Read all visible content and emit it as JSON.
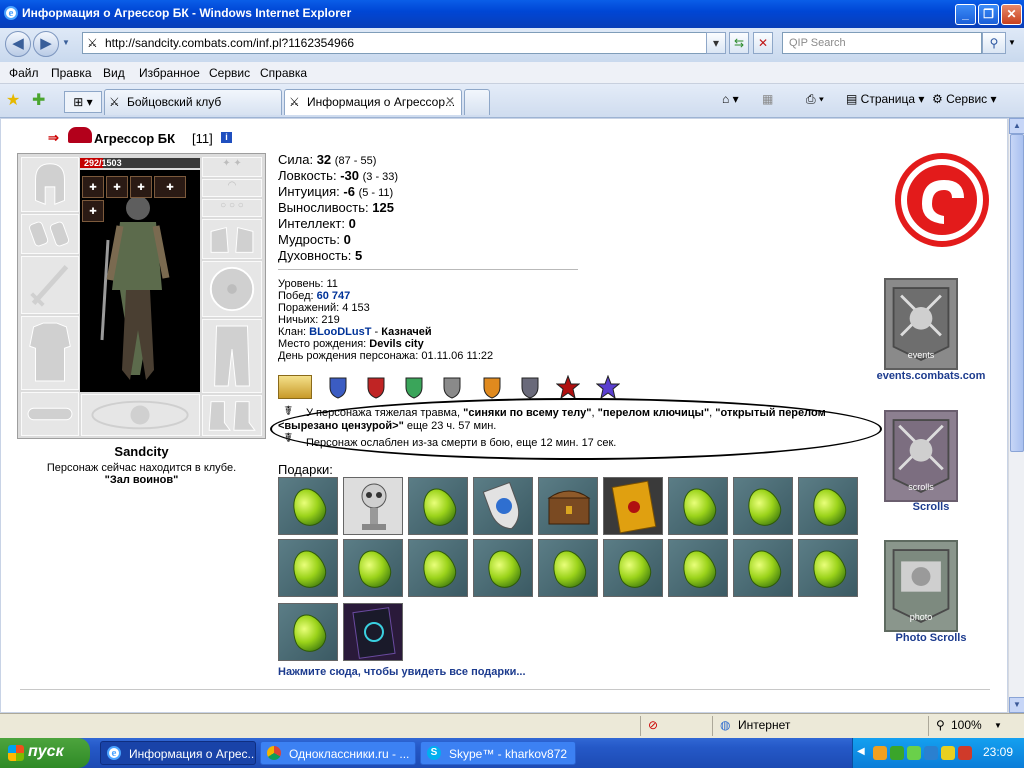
{
  "window": {
    "title": "Информация о Агрессор БК - Windows Internet Explorer"
  },
  "address_bar": {
    "url": "http://sandcity.combats.com/inf.pl?1162354966",
    "search_placeholder": "QIP Search"
  },
  "menu": [
    "Файл",
    "Правка",
    "Вид",
    "Избранное",
    "Сервис",
    "Справка"
  ],
  "tabs": [
    {
      "label": "Бойцовский клуб"
    },
    {
      "label": "Информация о Агрессор..."
    }
  ],
  "toolbar": {
    "page_label": "Страница",
    "service_label": "Сервис"
  },
  "character": {
    "name": "Агрессор БК",
    "level_tag": "[11]",
    "info_icon": "i",
    "hp": "292",
    "hp_max": "1503",
    "hp_fraction": 0.194,
    "city": "Sandcity",
    "location_text": "Персонаж сейчас находится в клубе.",
    "location_name": "\"Зал воинов\""
  },
  "stats": [
    {
      "name": "Сила:",
      "value": "32",
      "range": "(87 - 55)"
    },
    {
      "name": "Ловкость:",
      "value": "-30",
      "range": "(3 - 33)"
    },
    {
      "name": "Интуиция:",
      "value": "-6",
      "range": "(5 - 11)"
    },
    {
      "name": "Выносливость:",
      "value": "125",
      "range": ""
    },
    {
      "name": "Интеллект:",
      "value": "0",
      "range": ""
    },
    {
      "name": "Мудрость:",
      "value": "0",
      "range": ""
    },
    {
      "name": "Духовность:",
      "value": "5",
      "range": ""
    }
  ],
  "profile": {
    "level_label": "Уровень:",
    "level": "11",
    "wins_label": "Побед:",
    "wins": "60 747",
    "losses_label": "Поражений:",
    "losses": "4 153",
    "draws_label": "Ничьих:",
    "draws": "219",
    "clan_label": "Клан:",
    "clan": "BLooDLusT",
    "clan_sep": "-",
    "clan_role": "Казначей",
    "birthplace_label": "Место рождения:",
    "birthplace": "Devils city",
    "birthday_label": "День рождения персонажа:",
    "birthday": "01.11.06 11:22"
  },
  "trauma": {
    "prefix": "У персонажа тяжелая травма,",
    "injury1": "\"синяки по всему телу\"",
    "comma1": ",",
    "injury2": "\"перелом ключицы\"",
    "comma2": ",",
    "injury3_a": "\"открытый перелом",
    "injury3_b": "<вырезано цензурой>\"",
    "duration": "еще 23 ч. 57 мин.",
    "weakened": "Персонаж ослаблен из-за смерти в бою, еще 12 мин. 17 сек."
  },
  "gifts": {
    "title": "Подарки:",
    "more_link": "Нажмите сюда, чтобы увидеть все подарки..."
  },
  "side_links": {
    "events": "events.combats.com",
    "events_banner_text": "events",
    "scrolls": "Scrolls",
    "scrolls_banner_text": "scrolls",
    "photo_scrolls": "Photo Scrolls",
    "photo_banner_text": "photo"
  },
  "status_bar": {
    "zone": "Интернет",
    "zoom": "100%"
  },
  "taskbar": {
    "start": "пуск",
    "tasks": [
      {
        "label": "Информация о Агрес..."
      },
      {
        "label": "Одноклассники.ru - ..."
      },
      {
        "label": "Skype™ - kharkov872"
      }
    ],
    "clock": "23:09"
  },
  "colors": {
    "hp_bar": "#c40000",
    "link": "#1c3b8e",
    "gift_green": "#9bd31a",
    "logo_red": "#e31b1b"
  }
}
